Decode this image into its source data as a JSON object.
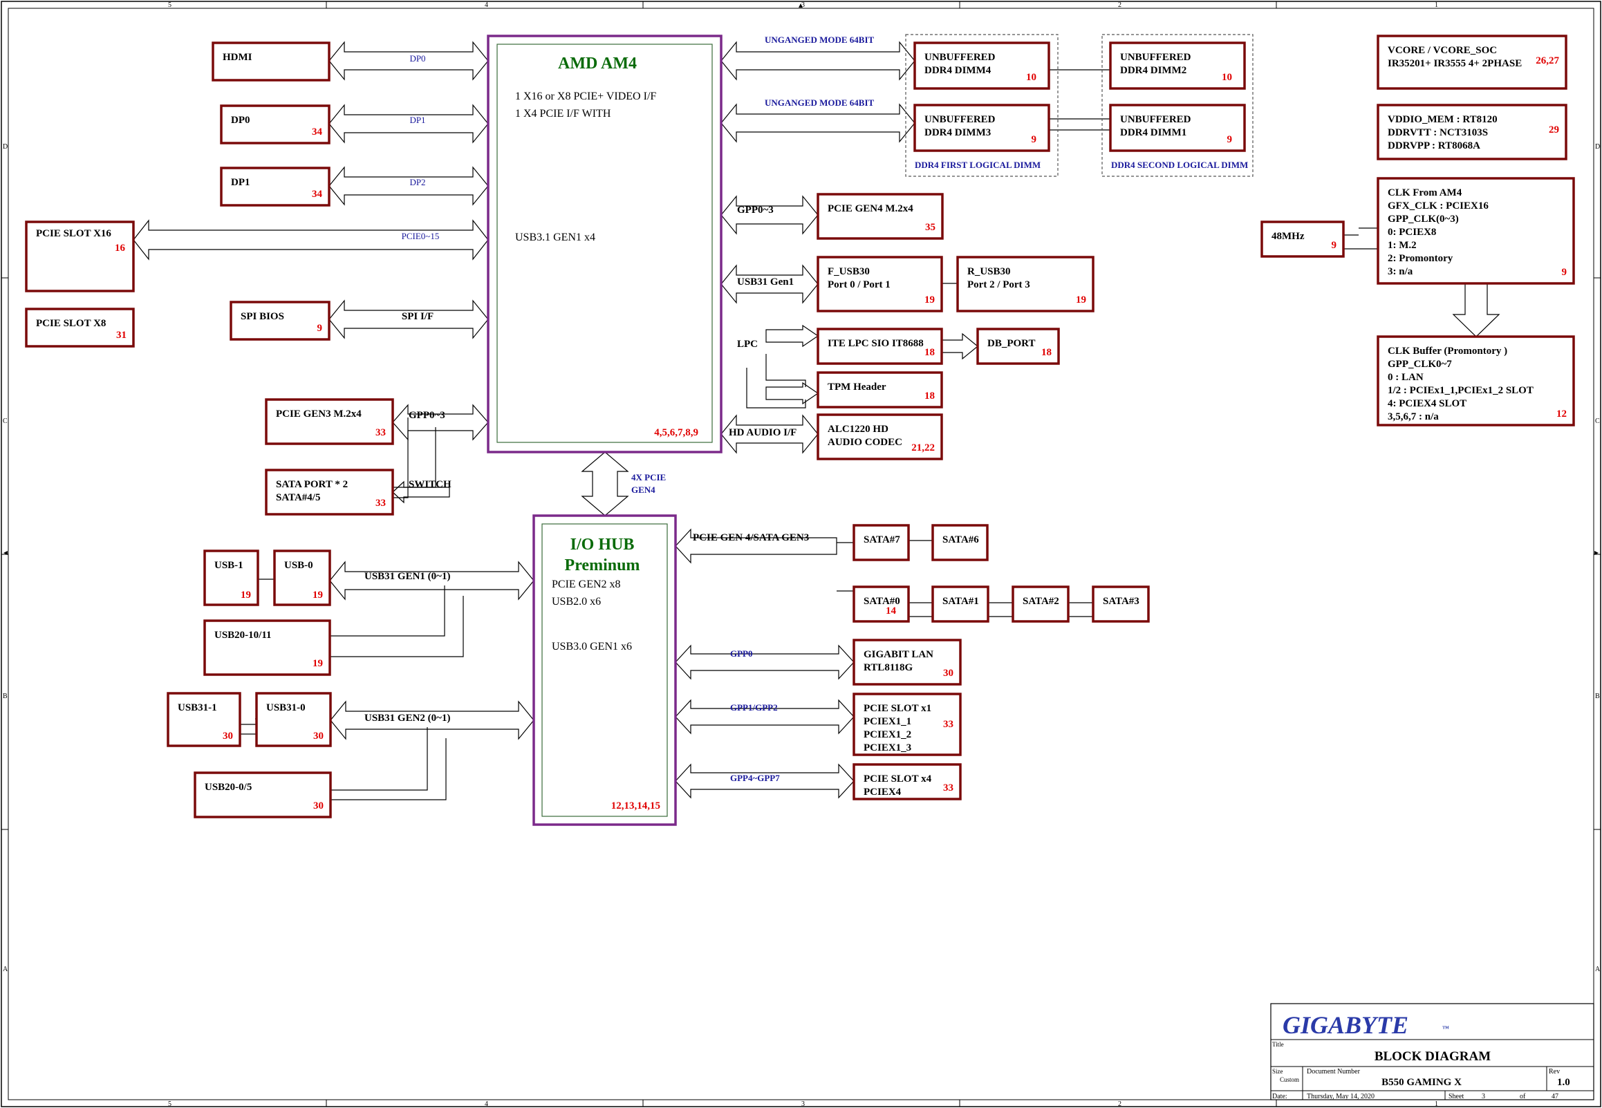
{
  "title_block": {
    "logo": "GIGABYTE",
    "title_label": "Title",
    "title": "BLOCK DIAGRAM",
    "size_label": "Size",
    "size": "Custom",
    "docnum_label": "Document Number",
    "docnum": "B550 GAMING X",
    "rev_label": "Rev",
    "rev": "1.0",
    "date_label": "Date:",
    "date": "Thursday, May 14, 2020",
    "sheet_label": "Sheet",
    "sheet": "3",
    "of_label": "of",
    "total": "47"
  },
  "frame": {
    "top_cols": [
      "5",
      "4",
      "3",
      "2",
      "1"
    ],
    "bottom_cols": [
      "5",
      "4",
      "3",
      "2",
      "1"
    ],
    "left_rows": [
      "D",
      "C",
      "B",
      "A"
    ],
    "right_rows": [
      "D",
      "C",
      "B",
      "A"
    ]
  },
  "cpu": {
    "title": "AMD AM4",
    "line1": "1 X16 or X8 PCIE+ VIDEO I/F",
    "line2": "1 X4 PCIE I/F WITH",
    "usb": "USB3.1 GEN1   x4",
    "pages": "4,5,6,7,8,9"
  },
  "hub": {
    "title1": "I/O HUB",
    "title2": "Preminum",
    "line1": "PCIE GEN2  x8",
    "line2": "USB2.0  x6",
    "line3": "USB3.0 GEN1 x6",
    "pages": "12,13,14,15"
  },
  "boxes": {
    "hdmi": {
      "l1": "HDMI"
    },
    "dp0": {
      "l1": "DP0",
      "pg": "34"
    },
    "dp1": {
      "l1": "DP1",
      "pg": "34"
    },
    "pcie16": {
      "l1": "PCIE SLOT X16",
      "pg": "16"
    },
    "pcie8": {
      "l1": "PCIE SLOT X8",
      "pg": "31"
    },
    "spibios": {
      "l1": "SPI BIOS",
      "pg": "9"
    },
    "m2gen3": {
      "l1": "PCIE GEN3  M.2x4",
      "pg": "33"
    },
    "sataport": {
      "l1": "SATA PORT * 2",
      "l2": "SATA#4/5",
      "pg": "33"
    },
    "dimm4": {
      "l1": "UNBUFFERED",
      "l2": "DDR4 DIMM4",
      "pg": "10"
    },
    "dimm2": {
      "l1": "UNBUFFERED",
      "l2": "DDR4 DIMM2",
      "pg": "10"
    },
    "dimm3": {
      "l1": "UNBUFFERED",
      "l2": "DDR4 DIMM3",
      "pg": "9"
    },
    "dimm1": {
      "l1": "UNBUFFERED",
      "l2": "DDR4 DIMM1",
      "pg": "9"
    },
    "m2gen4": {
      "l1": "PCIE GEN4  M.2x4",
      "pg": "35"
    },
    "fusb": {
      "l1": "F_USB30",
      "l2": "Port 0 / Port 1",
      "pg": "19"
    },
    "rusb": {
      "l1": "R_USB30",
      "l2": "Port 2 / Port 3",
      "pg": "19"
    },
    "ite": {
      "l1": "ITE LPC SIO IT8688",
      "pg": "18"
    },
    "dbport": {
      "l1": "DB_PORT",
      "pg": "18"
    },
    "tpm": {
      "l1": "TPM Header",
      "pg": "18"
    },
    "alc": {
      "l1": "ALC1220 HD",
      "l2": "AUDIO CODEC",
      "pg": "21,22"
    },
    "vcore": {
      "l1": "VCORE / VCORE_SOC",
      "l2": "IR35201+ IR3555  4+ 2PHASE",
      "pg": "26,27"
    },
    "vddio": {
      "l1": "VDDIO_MEM : RT8120",
      "l2": "DDRVTT : NCT3103S",
      "l3": "DDRVPP : RT8068A",
      "pg": "29"
    },
    "clk": {
      "l1": "CLK From AM4",
      "l2": "GFX_CLK :  PCIEX16",
      "l3": "GPP_CLK(0~3)",
      "l4": "0:  PCIEX8",
      "l5": "1:  M.2",
      "l6": "2:  Promontory",
      "l7": "3:  n/a",
      "pg": "9"
    },
    "osc": {
      "l1": "48MHz",
      "pg": "9"
    },
    "clkbuf": {
      "l1": "CLK Buffer (Promontory )",
      "l2": "GPP_CLK0~7",
      "l3": "0 : LAN",
      "l4": "1/2 : PCIEx1_1,PCIEx1_2  SLOT",
      "l5": "4:  PCIEX4 SLOT",
      "l6": "3,5,6,7 : n/a",
      "pg": "12"
    },
    "usb1": {
      "l1": "USB-1",
      "pg": "19"
    },
    "usb0": {
      "l1": "USB-0",
      "pg": "19"
    },
    "usb2011": {
      "l1": "USB20-10/11",
      "pg": "19"
    },
    "usb311": {
      "l1": "USB31-1",
      "pg": "30"
    },
    "usb310": {
      "l1": "USB31-0",
      "pg": "30"
    },
    "usb2005": {
      "l1": "USB20-0/5",
      "pg": "30"
    },
    "sata7": {
      "l1": "SATA#7"
    },
    "sata6": {
      "l1": "SATA#6"
    },
    "sata0": {
      "l1": "SATA#0",
      "pg": "14"
    },
    "sata1": {
      "l1": "SATA#1"
    },
    "sata2": {
      "l1": "SATA#2"
    },
    "sata3": {
      "l1": "SATA#3"
    },
    "lan": {
      "l1": "GIGABIT LAN",
      "l2": "RTL8118G",
      "pg": "30"
    },
    "slotx1": {
      "l1": "PCIE SLOT x1",
      "l2": "PCIEX1_1",
      "l3": "PCIEX1_2",
      "l4": "PCIEX1_3",
      "pg": "33"
    },
    "slotx4": {
      "l1": "PCIE SLOT x4",
      "l2": "PCIEX4",
      "pg": "33"
    }
  },
  "buses": {
    "dp0": "DP0",
    "dp1": "DP1",
    "dp2": "DP2",
    "pcie015": "PCIE0~15",
    "spi": "SPI I/F",
    "gpp03_left": "GPP0~3",
    "switch": "SWITCH",
    "unganged1": "UNGANGED MODE 64BIT",
    "unganged2": "UNGANGED MODE 64BIT",
    "ddr_first": "DDR4 FIRST LOGICAL DIMM",
    "ddr_second": "DDR4 SECOND LOGICAL DIMM",
    "gpp03_right": "GPP0~3",
    "usb31gen1": "USB31 Gen1",
    "lpc": "LPC",
    "hdaudio": "HD AUDIO I/F",
    "x4pcie1": "4X PCIE",
    "x4pcie2": "GEN4",
    "pciegen4sata": "PCIE GEN 4/SATA GEN3",
    "gpp0": "GPP0",
    "gpp12": "GPP1/GPP2",
    "gpp47": "GPP4~GPP7",
    "usb31gen1_01": "USB31 GEN1 (0~1)",
    "usb31gen2_01": "USB31 GEN2 (0~1)"
  },
  "colors": {
    "box_border": "#7a0a0a",
    "cpu_border": "#7b2a8a",
    "inner_border": "#3a6b3a",
    "page_ref": "#e00000",
    "bus_blue": "#1a1a9c",
    "header_green": "#0a6b0a",
    "logo_blue": "#2a3aa8"
  }
}
